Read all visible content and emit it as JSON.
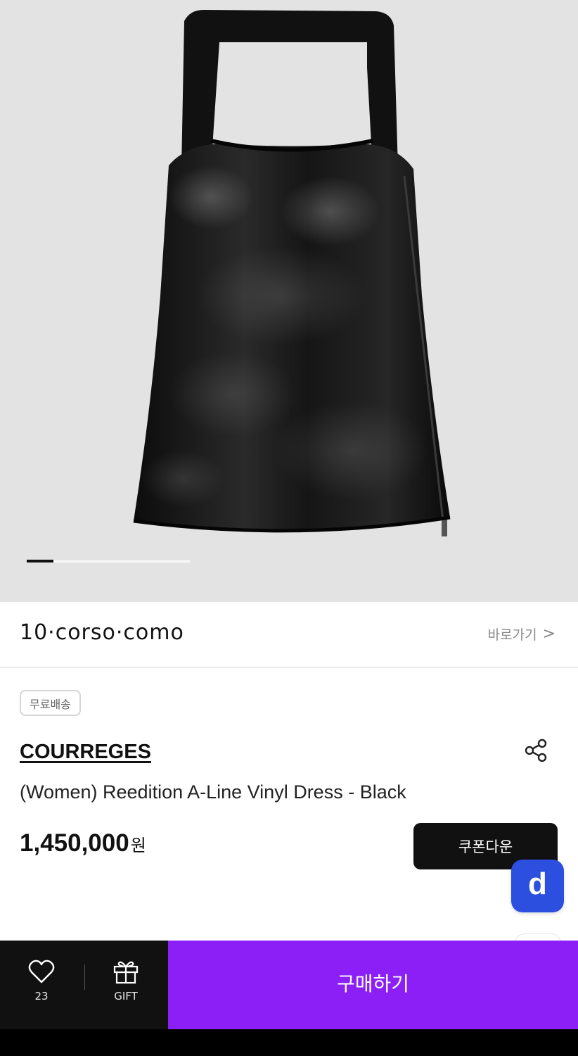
{
  "store": {
    "logo_text": "10·corso·como",
    "link_label": "바로가기",
    "link_chevron": ">"
  },
  "carousel": {
    "active_index": 1
  },
  "product": {
    "badge": "무료배송",
    "brand": "COURREGES",
    "title": "(Women) Reedition A-Line Vinyl Dress - Black",
    "price": "1,450,000",
    "currency": "원",
    "coupon_label": "쿠폰다운",
    "fab_letter": "d"
  },
  "bottom_bar": {
    "like_count": "23",
    "gift_label": "GIFT",
    "buy_label": "구매하기"
  },
  "colors": {
    "buy_button": "#8b1ff5",
    "fab": "#2c4fe0",
    "hero_bg": "#e3e3e3"
  },
  "icons": [
    "heart-icon",
    "gift-icon",
    "share-icon",
    "chevron-right-icon"
  ]
}
